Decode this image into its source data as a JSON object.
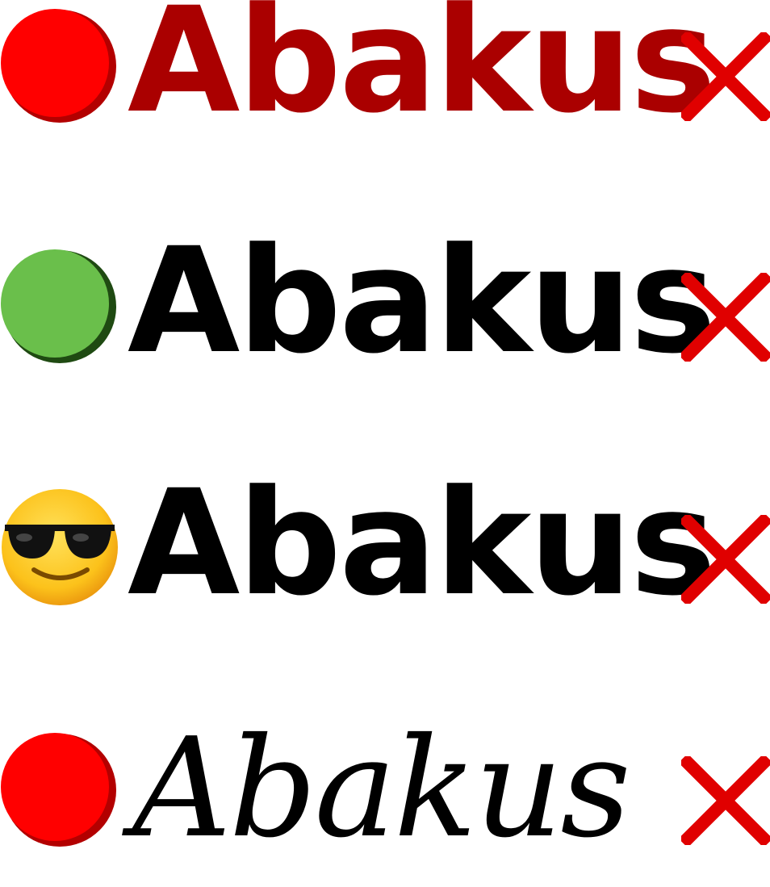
{
  "rows": [
    {
      "text": "Abakus",
      "text_color": "#aa0000",
      "badge": "red-circle-icon",
      "badge_color": "#ff0000",
      "badge_shadow": "#b30000",
      "action_icon": "close-icon"
    },
    {
      "text": "Abakus",
      "text_color": "#000000",
      "badge": "green-circle-icon",
      "badge_color": "#6abf4b",
      "badge_shadow": "#1f4a12",
      "action_icon": "close-icon"
    },
    {
      "text": "Abakus",
      "text_color": "#000000",
      "badge": "sunglasses-emoji-icon",
      "badge_color": "#fcc21b",
      "action_icon": "close-icon"
    },
    {
      "text": "Abakus",
      "text_color": "#000000",
      "badge": "red-circle-icon",
      "badge_color": "#ff0000",
      "badge_shadow": "#b30000",
      "action_icon": "close-icon"
    }
  ],
  "close_icon_color": "#e00000"
}
